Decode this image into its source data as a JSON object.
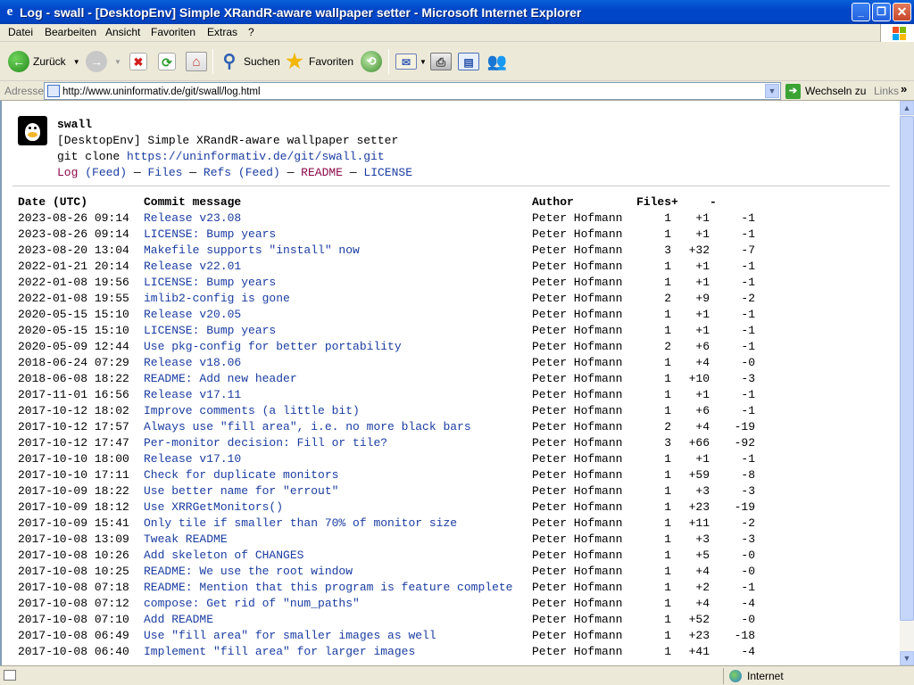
{
  "window": {
    "title": "Log - swall - [DesktopEnv] Simple XRandR-aware wallpaper setter - Microsoft Internet Explorer"
  },
  "menu": [
    "Datei",
    "Bearbeiten",
    "Ansicht",
    "Favoriten",
    "Extras",
    "?"
  ],
  "toolbar": {
    "back": "Zurück",
    "search": "Suchen",
    "favorites": "Favoriten"
  },
  "address": {
    "label": "Adresse",
    "url": "http://www.uninformativ.de/git/swall/log.html",
    "go": "Wechseln zu",
    "links": "Links"
  },
  "repo": {
    "name": "swall",
    "description": "[DesktopEnv] Simple XRandR-aware wallpaper setter",
    "clone_prefix": "git clone ",
    "clone_url": "https://uninformativ.de/git/swall.git",
    "nav": {
      "log": "Log",
      "feed1": "Feed",
      "files": "Files",
      "refs": "Refs",
      "feed2": "Feed",
      "readme": "README",
      "license": "LICENSE"
    }
  },
  "table": {
    "headers": [
      "Date (UTC)",
      "Commit message",
      "Author",
      "Files",
      "+",
      "-"
    ],
    "rows": [
      {
        "date": "2023-08-26 09:14",
        "msg": "Release v23.08",
        "author": "Peter Hofmann",
        "files": "1",
        "add": "+1",
        "del": "-1"
      },
      {
        "date": "2023-08-26 09:14",
        "msg": "LICENSE: Bump years",
        "author": "Peter Hofmann",
        "files": "1",
        "add": "+1",
        "del": "-1"
      },
      {
        "date": "2023-08-20 13:04",
        "msg": "Makefile supports \"install\" now",
        "author": "Peter Hofmann",
        "files": "3",
        "add": "+32",
        "del": "-7"
      },
      {
        "date": "2022-01-21 20:14",
        "msg": "Release v22.01",
        "author": "Peter Hofmann",
        "files": "1",
        "add": "+1",
        "del": "-1"
      },
      {
        "date": "2022-01-08 19:56",
        "msg": "LICENSE: Bump years",
        "author": "Peter Hofmann",
        "files": "1",
        "add": "+1",
        "del": "-1"
      },
      {
        "date": "2022-01-08 19:55",
        "msg": "imlib2-config is gone",
        "author": "Peter Hofmann",
        "files": "2",
        "add": "+9",
        "del": "-2"
      },
      {
        "date": "2020-05-15 15:10",
        "msg": "Release v20.05",
        "author": "Peter Hofmann",
        "files": "1",
        "add": "+1",
        "del": "-1"
      },
      {
        "date": "2020-05-15 15:10",
        "msg": "LICENSE: Bump years",
        "author": "Peter Hofmann",
        "files": "1",
        "add": "+1",
        "del": "-1"
      },
      {
        "date": "2020-05-09 12:44",
        "msg": "Use pkg-config for better portability",
        "author": "Peter Hofmann",
        "files": "2",
        "add": "+6",
        "del": "-1"
      },
      {
        "date": "2018-06-24 07:29",
        "msg": "Release v18.06",
        "author": "Peter Hofmann",
        "files": "1",
        "add": "+4",
        "del": "-0"
      },
      {
        "date": "2018-06-08 18:22",
        "msg": "README: Add new header",
        "author": "Peter Hofmann",
        "files": "1",
        "add": "+10",
        "del": "-3"
      },
      {
        "date": "2017-11-01 16:56",
        "msg": "Release v17.11",
        "author": "Peter Hofmann",
        "files": "1",
        "add": "+1",
        "del": "-1"
      },
      {
        "date": "2017-10-12 18:02",
        "msg": "Improve comments (a little bit)",
        "author": "Peter Hofmann",
        "files": "1",
        "add": "+6",
        "del": "-1"
      },
      {
        "date": "2017-10-12 17:57",
        "msg": "Always use \"fill area\", i.e. no more black bars",
        "author": "Peter Hofmann",
        "files": "2",
        "add": "+4",
        "del": "-19"
      },
      {
        "date": "2017-10-12 17:47",
        "msg": "Per-monitor decision: Fill or tile?",
        "author": "Peter Hofmann",
        "files": "3",
        "add": "+66",
        "del": "-92"
      },
      {
        "date": "2017-10-10 18:00",
        "msg": "Release v17.10",
        "author": "Peter Hofmann",
        "files": "1",
        "add": "+1",
        "del": "-1"
      },
      {
        "date": "2017-10-10 17:11",
        "msg": "Check for duplicate monitors",
        "author": "Peter Hofmann",
        "files": "1",
        "add": "+59",
        "del": "-8"
      },
      {
        "date": "2017-10-09 18:22",
        "msg": "Use better name for \"errout\"",
        "author": "Peter Hofmann",
        "files": "1",
        "add": "+3",
        "del": "-3"
      },
      {
        "date": "2017-10-09 18:12",
        "msg": "Use XRRGetMonitors()",
        "author": "Peter Hofmann",
        "files": "1",
        "add": "+23",
        "del": "-19"
      },
      {
        "date": "2017-10-09 15:41",
        "msg": "Only tile if smaller than 70% of monitor size",
        "author": "Peter Hofmann",
        "files": "1",
        "add": "+11",
        "del": "-2"
      },
      {
        "date": "2017-10-08 13:09",
        "msg": "Tweak README",
        "author": "Peter Hofmann",
        "files": "1",
        "add": "+3",
        "del": "-3"
      },
      {
        "date": "2017-10-08 10:26",
        "msg": "Add skeleton of CHANGES",
        "author": "Peter Hofmann",
        "files": "1",
        "add": "+5",
        "del": "-0"
      },
      {
        "date": "2017-10-08 10:25",
        "msg": "README: We use the root window",
        "author": "Peter Hofmann",
        "files": "1",
        "add": "+4",
        "del": "-0"
      },
      {
        "date": "2017-10-08 07:18",
        "msg": "README: Mention that this program is feature complete",
        "author": "Peter Hofmann",
        "files": "1",
        "add": "+2",
        "del": "-1"
      },
      {
        "date": "2017-10-08 07:12",
        "msg": "compose: Get rid of \"num_paths\"",
        "author": "Peter Hofmann",
        "files": "1",
        "add": "+4",
        "del": "-4"
      },
      {
        "date": "2017-10-08 07:10",
        "msg": "Add README",
        "author": "Peter Hofmann",
        "files": "1",
        "add": "+52",
        "del": "-0"
      },
      {
        "date": "2017-10-08 06:49",
        "msg": "Use \"fill area\" for smaller images as well",
        "author": "Peter Hofmann",
        "files": "1",
        "add": "+23",
        "del": "-18"
      },
      {
        "date": "2017-10-08 06:40",
        "msg": "Implement \"fill area\" for larger images",
        "author": "Peter Hofmann",
        "files": "1",
        "add": "+41",
        "del": "-4"
      }
    ]
  },
  "status": {
    "zone": "Internet"
  }
}
